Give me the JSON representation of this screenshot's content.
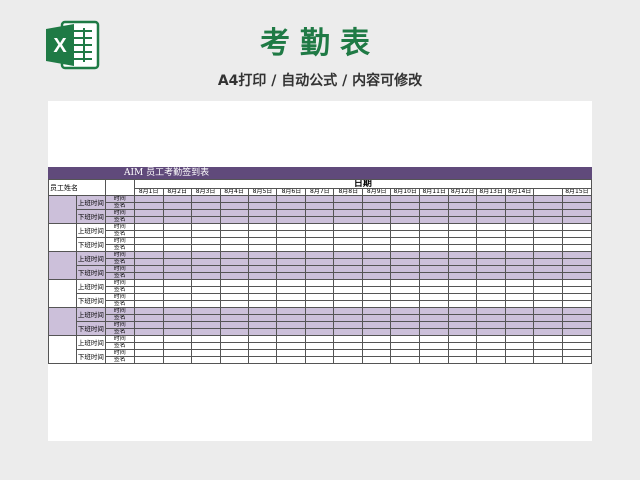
{
  "header": {
    "logo_icon": "excel-icon",
    "title": "考勤表",
    "subtitle": "A4打印 / 自动公式 / 内容可修改",
    "colors": {
      "brand": "#1f7a45",
      "accent": "#604a7b",
      "band": "#ccc0da"
    }
  },
  "sheet": {
    "title": "AIM 员工考勤签到表",
    "name_header": "员工姓名",
    "date_header": "日期",
    "days": [
      "8月1日",
      "8月2日",
      "8月3日",
      "8月4日",
      "8月5日",
      "8月6日",
      "8月7日",
      "8月8日",
      "8月9日",
      "8月10日",
      "8月11日",
      "8月12日",
      "8月13日",
      "8月14日",
      "",
      "8月15日"
    ],
    "shift_labels": [
      "上班时间",
      "下班时间"
    ],
    "row_labels": [
      "时间",
      "签名"
    ],
    "employee_count": 6
  }
}
